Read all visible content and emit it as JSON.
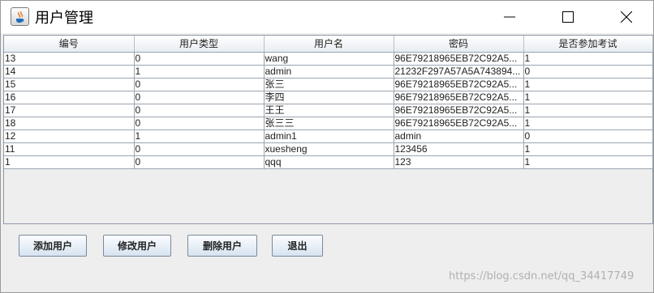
{
  "window": {
    "title": "用户管理",
    "app_icon": "java-icon"
  },
  "table": {
    "columns": [
      "编号",
      "用户类型",
      "用户名",
      "密码",
      "是否参加考试"
    ],
    "rows": [
      [
        "13",
        "0",
        "wang",
        "96E79218965EB72C92A5...",
        "1"
      ],
      [
        "14",
        "1",
        "admin",
        "21232F297A57A5A743894...",
        "0"
      ],
      [
        "15",
        "0",
        "张三",
        "96E79218965EB72C92A5...",
        "1"
      ],
      [
        "16",
        "0",
        "李四",
        "96E79218965EB72C92A5...",
        "1"
      ],
      [
        "17",
        "0",
        "王王",
        "96E79218965EB72C92A5...",
        "1"
      ],
      [
        "18",
        "0",
        "张三三",
        "96E79218965EB72C92A5...",
        "1"
      ],
      [
        "12",
        "1",
        "admin1",
        "admin",
        "0"
      ],
      [
        "11",
        "0",
        "xuesheng",
        "123456",
        "1"
      ],
      [
        "1",
        "0",
        "qqq",
        "123",
        "1"
      ]
    ]
  },
  "buttons": {
    "add": "添加用户",
    "edit": "修改用户",
    "delete": "删除用户",
    "exit": "退出"
  },
  "watermark": "https://blog.csdn.net/qq_34417749"
}
